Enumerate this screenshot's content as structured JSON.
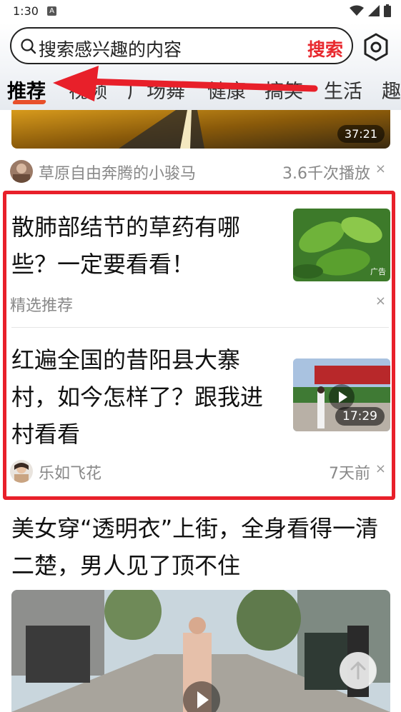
{
  "status_bar": {
    "time": "1:30",
    "notification_letter": "A"
  },
  "search": {
    "placeholder": "搜索感兴趣的内容",
    "button_label": "搜索"
  },
  "tabs": [
    "推荐",
    "视频",
    "广场舞",
    "健康",
    "搞笑",
    "生活",
    "趣"
  ],
  "active_tab_index": 0,
  "feed": {
    "top_video": {
      "duration": "37:21",
      "author": "草原自由奔腾的小骏马",
      "plays": "3.6千次播放"
    },
    "ad_card": {
      "title_line1": "散肺部结节的草药有哪",
      "title_line2": "些？一定要看看！",
      "source": "精选推荐",
      "ad_label": "广告"
    },
    "video_card": {
      "title_line1": "红遍全国的昔阳县大寨",
      "title_line2": "村，如今怎样了？跟我进",
      "title_line3": "村看看",
      "duration": "17:29",
      "author": "乐如飞花",
      "time_ago": "7天前"
    },
    "article_card": {
      "title_line1": "美女穿“透明衣”上街，全身看得一清",
      "title_line2": "二楚，男人见了顶不住"
    }
  },
  "close_symbol": "×",
  "colors": {
    "accent_red": "#e8292f",
    "annotation_red": "#e8202a"
  }
}
